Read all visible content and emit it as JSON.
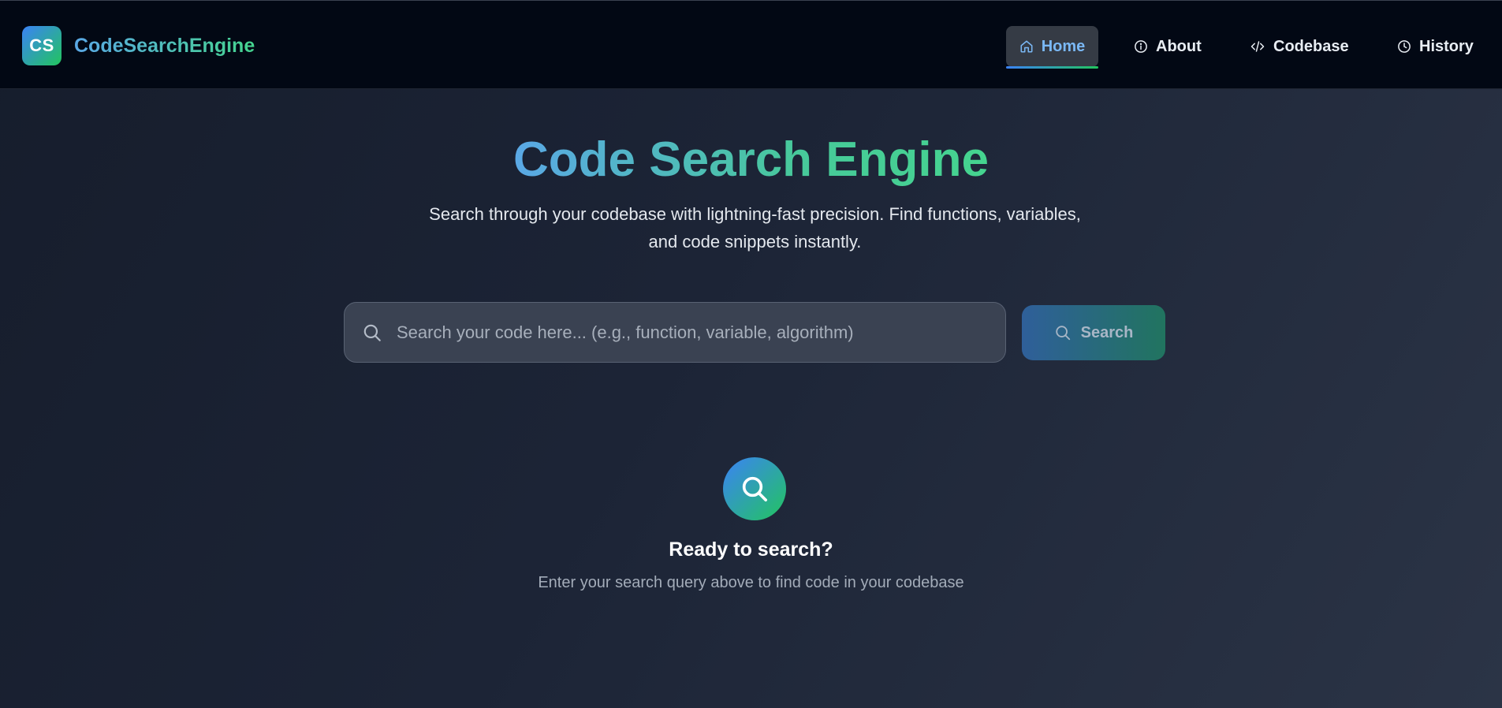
{
  "navbar": {
    "logo_text": "CS",
    "brand_name": "CodeSearchEngine",
    "items": [
      {
        "label": "Home",
        "icon": "home-icon",
        "active": true
      },
      {
        "label": "About",
        "icon": "info-icon",
        "active": false
      },
      {
        "label": "Codebase",
        "icon": "code-icon",
        "active": false
      },
      {
        "label": "History",
        "icon": "clock-icon",
        "active": false
      }
    ]
  },
  "hero": {
    "title": "Code Search Engine",
    "subtitle": "Search through your codebase with lightning-fast precision. Find functions, variables, and code snippets instantly."
  },
  "search": {
    "placeholder": "Search your code here... (e.g., function, variable, algorithm)",
    "value": "",
    "button_label": "Search"
  },
  "empty_state": {
    "icon": "search-icon",
    "title": "Ready to search?",
    "message": "Enter your search query above to find code in your codebase"
  },
  "colors": {
    "accent_blue": "#3b82f6",
    "accent_green": "#22c55e",
    "nav_background": "#020814",
    "active_nav_text": "#7ab8f5"
  }
}
